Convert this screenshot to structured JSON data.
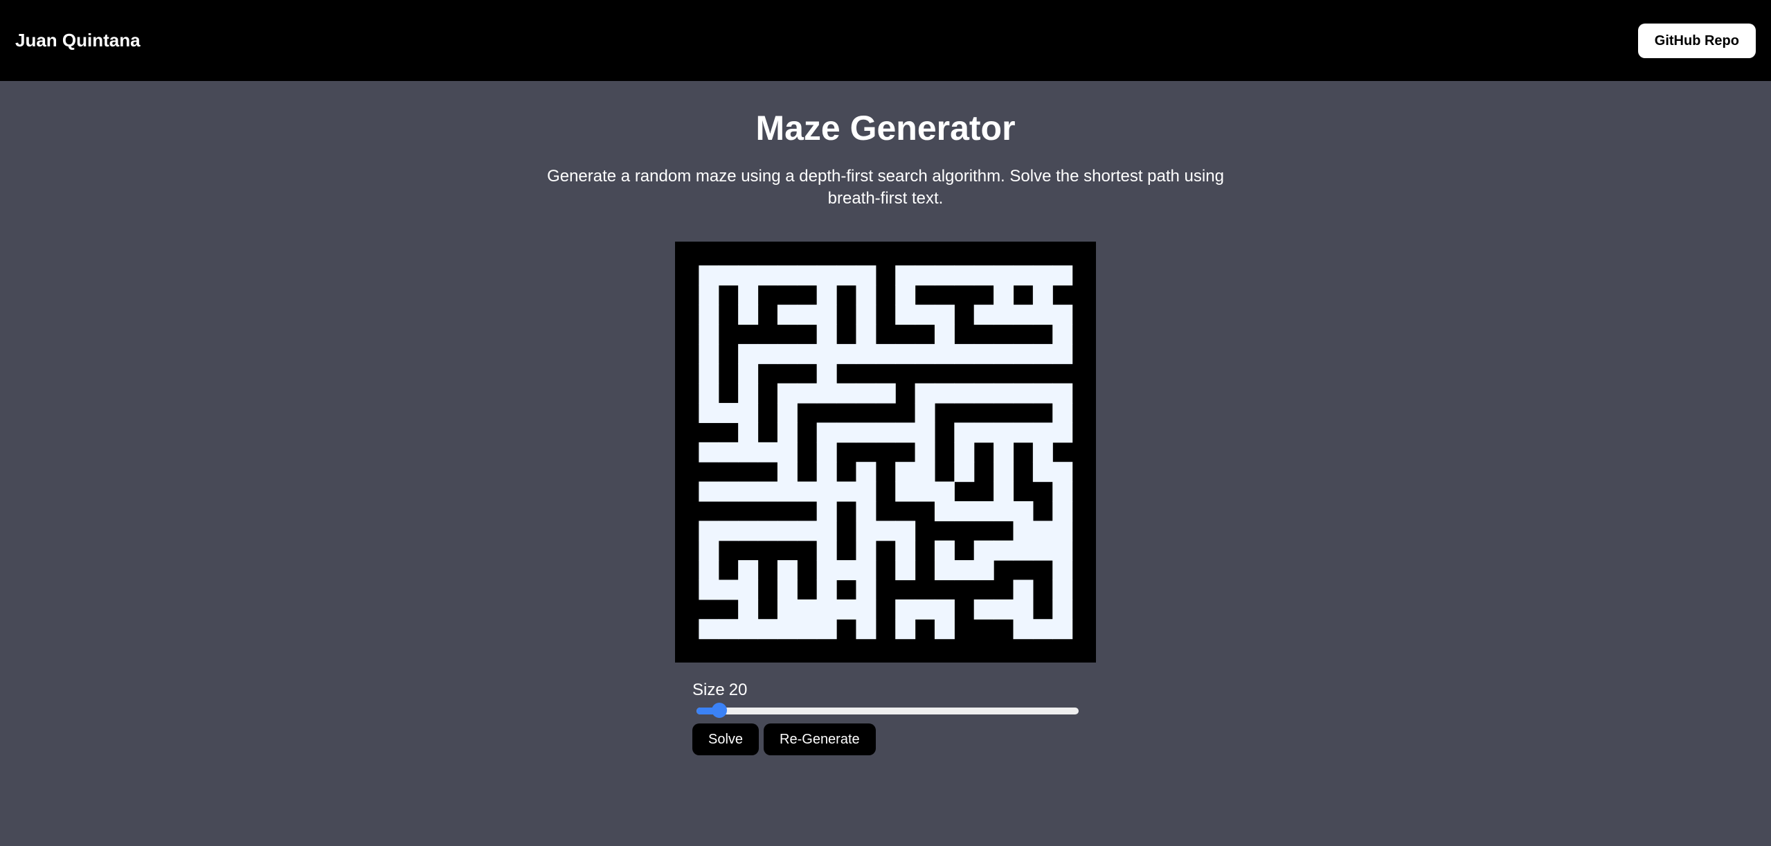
{
  "nav": {
    "brand": "Juan Quintana",
    "github_label": "GitHub Repo"
  },
  "main": {
    "title": "Maze Generator",
    "description": "Generate a random maze using a depth-first search algorithm. Solve the shortest path using breath-first text."
  },
  "maze": {
    "grid_size": 20,
    "wall_color": "#000000",
    "path_color": "#eff6ff",
    "rows": [
      "000000000000000000000",
      "011111111101111111110",
      "010100010101000010100",
      "010101110101110111110",
      "010000010100010000010",
      "010111111111111111110",
      "010100010000000000000",
      "010101111110111111110",
      "011101000000100000010",
      "000101011111101111110",
      "011111010000101010100",
      "000001010101101010110",
      "011111111101110010010",
      "000000010100011111010",
      "011111110111000001110",
      "010000010101010111110",
      "010101011101011100010",
      "011101010100000001010",
      "000101111101110111010",
      "011111110101010001110",
      "000000000000000000000"
    ]
  },
  "controls": {
    "size_label": "Size",
    "size_value": "20",
    "slider_fraction": 0.04,
    "solve_label": "Solve",
    "regenerate_label": "Re-Generate"
  },
  "colors": {
    "background": "#484a57",
    "navbar": "#000000",
    "accent": "#3b82f6"
  }
}
